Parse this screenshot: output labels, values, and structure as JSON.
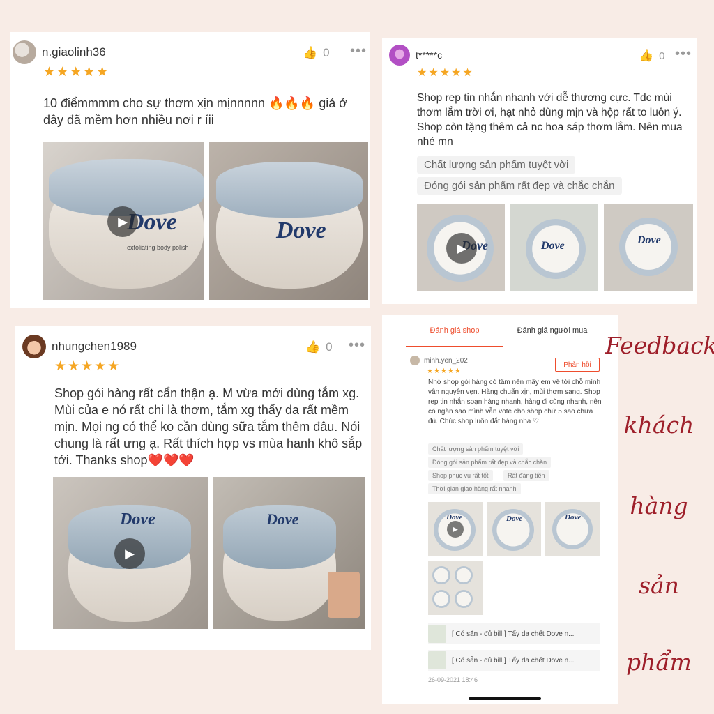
{
  "colors": {
    "background": "#f8ece6",
    "accent": "#ee4d2d",
    "star": "#f5a623",
    "script_text": "#9e1f2a"
  },
  "reviews": [
    {
      "username": "n.giaolinh36",
      "likes": "0",
      "rating": "★★★★★",
      "text": "10 điểmmmm cho sự thơm xịn mịnnnnn 🔥🔥🔥 giá ở đây đã mềm hơn nhiều nơi r íii",
      "photo_brand": "Dove",
      "photo_caption": "exfoliating body polish"
    },
    {
      "username": "t*****c",
      "likes": "0",
      "rating": "★★★★★",
      "text": "Shop rep tin nhắn nhanh với dễ thương cực. Tdc mùi thơm lắm trời ơi, hạt nhỏ dùng mịn và hộp rất to luôn ý. Shop còn tặng thêm cả nc hoa sáp thơm lắm. Nên mua nhé mn",
      "tags": [
        "Chất lượng sản phẩm tuyệt vời",
        "Đóng gói sản phẩm rất đẹp và chắc chắn"
      ],
      "photo_brand": "Dove"
    },
    {
      "username": "nhungchen1989",
      "likes": "0",
      "rating": "★★★★★",
      "text": "Shop gói hàng rất cẩn thận ạ. M vừa mới dùng tắm xg. Mùi của e nó rất chi là thơm, tắm xg thấy da rất mềm mịn. Mọi ng có thể ko cần dùng sữa tắm thêm đâu. Nói chung là rất ưng ạ. Rất thích hợp vs mùa hanh khô sắp tới. Thanks shop❤️❤️❤️",
      "photo_brand": "Dove"
    }
  ],
  "phone": {
    "tabs": [
      "Đánh giá shop",
      "Đánh giá người mua"
    ],
    "username": "minh.yen_202",
    "reply_label": "Phản hồi",
    "rating": "★★★★★",
    "text": "Nhờ shop gói hàng có tâm nên mấy em về tới chỗ mình vẫn nguyên vẹn. Hàng chuẩn xịn, mùi thơm sang. Shop rep tin nhắn soạn hàng nhanh, hàng đi cũng nhanh, nên có ngàn sao mình vẫn vote cho shop chứ 5 sao chưa đủ. Chúc shop luôn đắt hàng nha ♡",
    "tags": [
      "Chất lượng sản phẩm tuyệt vời",
      "Đóng gói sản phẩm rất đẹp và chắc chắn",
      "Shop phục vụ rất tốt",
      "Rất đáng tiền",
      "Thời gian giao hàng rất nhanh"
    ],
    "product_rows": [
      "[ Có sẵn - đủ bill ] Tẩy da chết Dove n...",
      "[ Có sẵn - đủ bill ] Tẩy da chết Dove n..."
    ],
    "date": "26-09-2021 18:46",
    "photo_brand": "Dove"
  },
  "side_text": [
    "Feedback",
    "khách",
    "hàng",
    "sản",
    "phẩm"
  ],
  "icons": {
    "like": "thumbs-up-icon",
    "more": "more-dots-icon",
    "play": "play-icon"
  }
}
